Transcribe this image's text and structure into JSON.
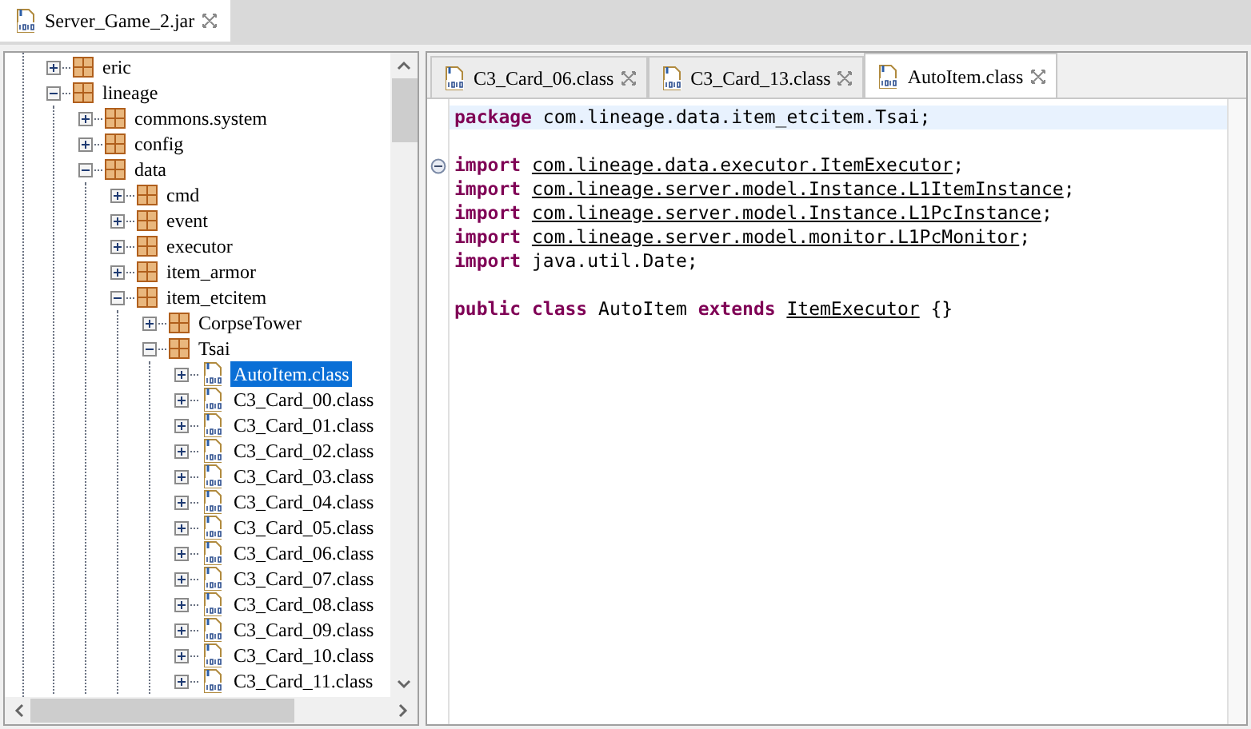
{
  "outer_tab": {
    "label": "Server_Game_2.jar",
    "selected": true
  },
  "tree": [
    {
      "label": "eric",
      "kind": "package",
      "expanded": false,
      "selected": false
    },
    {
      "label": "lineage",
      "kind": "package",
      "expanded": true,
      "selected": false,
      "children": [
        {
          "label": "commons.system",
          "kind": "package",
          "expanded": false,
          "selected": false
        },
        {
          "label": "config",
          "kind": "package",
          "expanded": false,
          "selected": false
        },
        {
          "label": "data",
          "kind": "package",
          "expanded": true,
          "selected": false,
          "children": [
            {
              "label": "cmd",
              "kind": "package",
              "expanded": false,
              "selected": false
            },
            {
              "label": "event",
              "kind": "package",
              "expanded": false,
              "selected": false
            },
            {
              "label": "executor",
              "kind": "package",
              "expanded": false,
              "selected": false
            },
            {
              "label": "item_armor",
              "kind": "package",
              "expanded": false,
              "selected": false
            },
            {
              "label": "item_etcitem",
              "kind": "package",
              "expanded": true,
              "selected": false,
              "children": [
                {
                  "label": "CorpseTower",
                  "kind": "package",
                  "expanded": false,
                  "selected": false
                },
                {
                  "label": "Tsai",
                  "kind": "package",
                  "expanded": true,
                  "selected": false,
                  "children": [
                    {
                      "label": "AutoItem.class",
                      "kind": "class",
                      "expanded": false,
                      "selected": true
                    },
                    {
                      "label": "C3_Card_00.class",
                      "kind": "class",
                      "expanded": false,
                      "selected": false
                    },
                    {
                      "label": "C3_Card_01.class",
                      "kind": "class",
                      "expanded": false,
                      "selected": false
                    },
                    {
                      "label": "C3_Card_02.class",
                      "kind": "class",
                      "expanded": false,
                      "selected": false
                    },
                    {
                      "label": "C3_Card_03.class",
                      "kind": "class",
                      "expanded": false,
                      "selected": false
                    },
                    {
                      "label": "C3_Card_04.class",
                      "kind": "class",
                      "expanded": false,
                      "selected": false
                    },
                    {
                      "label": "C3_Card_05.class",
                      "kind": "class",
                      "expanded": false,
                      "selected": false
                    },
                    {
                      "label": "C3_Card_06.class",
                      "kind": "class",
                      "expanded": false,
                      "selected": false
                    },
                    {
                      "label": "C3_Card_07.class",
                      "kind": "class",
                      "expanded": false,
                      "selected": false
                    },
                    {
                      "label": "C3_Card_08.class",
                      "kind": "class",
                      "expanded": false,
                      "selected": false
                    },
                    {
                      "label": "C3_Card_09.class",
                      "kind": "class",
                      "expanded": false,
                      "selected": false
                    },
                    {
                      "label": "C3_Card_10.class",
                      "kind": "class",
                      "expanded": false,
                      "selected": false
                    },
                    {
                      "label": "C3_Card_11.class",
                      "kind": "class",
                      "expanded": false,
                      "selected": false
                    }
                  ]
                }
              ]
            }
          ]
        }
      ]
    }
  ],
  "editor_tabs": [
    {
      "label": "C3_Card_06.class",
      "selected": false
    },
    {
      "label": "C3_Card_13.class",
      "selected": false
    },
    {
      "label": "AutoItem.class",
      "selected": true
    }
  ],
  "code_lines": [
    {
      "current": true,
      "foldable": false,
      "tokens": [
        {
          "kind": "keyword",
          "text": "package"
        },
        {
          "kind": "plain",
          "text": "com.lineage.data.item_etcitem.Tsai;",
          "spaced": true
        }
      ]
    },
    {
      "current": false,
      "foldable": false
    },
    {
      "current": false,
      "foldable": true,
      "tokens": [
        {
          "kind": "keyword",
          "text": "import"
        },
        {
          "kind": "link",
          "text": "com.lineage.data.executor.ItemExecutor",
          "spaced": true
        },
        {
          "kind": "plain",
          "text": ";"
        }
      ]
    },
    {
      "current": false,
      "foldable": false,
      "tokens": [
        {
          "kind": "keyword",
          "text": "import"
        },
        {
          "kind": "link",
          "text": "com.lineage.server.model.Instance.L1ItemInstance",
          "spaced": true
        },
        {
          "kind": "plain",
          "text": ";"
        }
      ]
    },
    {
      "current": false,
      "foldable": false,
      "tokens": [
        {
          "kind": "keyword",
          "text": "import"
        },
        {
          "kind": "link",
          "text": "com.lineage.server.model.Instance.L1PcInstance",
          "spaced": true
        },
        {
          "kind": "plain",
          "text": ";"
        }
      ]
    },
    {
      "current": false,
      "foldable": false,
      "tokens": [
        {
          "kind": "keyword",
          "text": "import"
        },
        {
          "kind": "link",
          "text": "com.lineage.server.model.monitor.L1PcMonitor",
          "spaced": true
        },
        {
          "kind": "plain",
          "text": ";"
        }
      ]
    },
    {
      "current": false,
      "foldable": false,
      "tokens": [
        {
          "kind": "keyword",
          "text": "import"
        },
        {
          "kind": "plain",
          "text": "java.util.Date;",
          "spaced": true
        }
      ]
    },
    {
      "current": false,
      "foldable": false
    },
    {
      "current": false,
      "foldable": false,
      "tokens": [
        {
          "kind": "keyword",
          "text": "public"
        },
        {
          "kind": "keyword",
          "text": "class",
          "spaced": true
        },
        {
          "kind": "plain",
          "text": "AutoItem",
          "spaced": true
        },
        {
          "kind": "keyword",
          "text": "extends",
          "spaced": true
        },
        {
          "kind": "link",
          "text": "ItemExecutor",
          "spaced": true
        },
        {
          "kind": "plain",
          "text": "{}",
          "spaced": true
        }
      ]
    }
  ]
}
